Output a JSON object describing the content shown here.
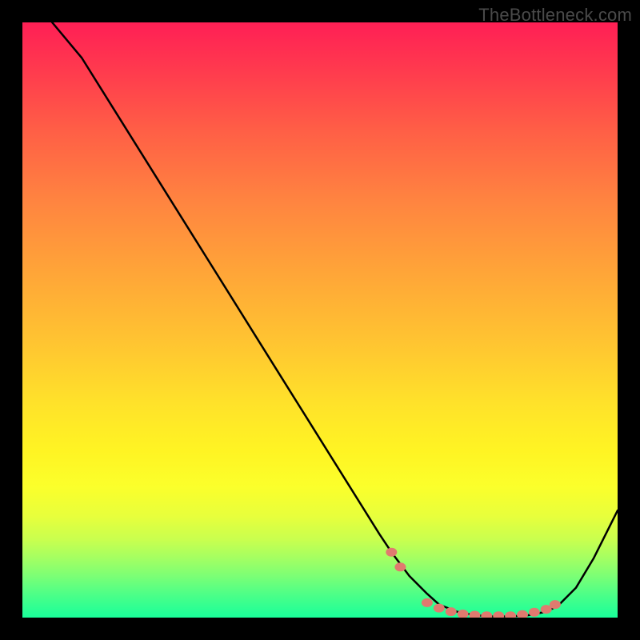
{
  "watermark": {
    "text": "TheBottleneck.com"
  },
  "chart_data": {
    "type": "line",
    "title": "",
    "xlabel": "",
    "ylabel": "",
    "xlim": [
      0,
      100
    ],
    "ylim": [
      0,
      100
    ],
    "grid": false,
    "legend": false,
    "series": [
      {
        "name": "bottleneck-curve",
        "color": "#000000",
        "x": [
          5,
          10,
          15,
          20,
          25,
          30,
          35,
          40,
          45,
          50,
          55,
          60,
          62,
          65,
          68,
          70,
          73,
          76,
          79,
          82,
          85,
          88,
          90,
          93,
          96,
          100
        ],
        "values": [
          100,
          94,
          86,
          78,
          70,
          62,
          54,
          46,
          38,
          30,
          22,
          14,
          11,
          7,
          4,
          2.2,
          1.0,
          0.4,
          0.2,
          0.2,
          0.4,
          1.0,
          2.0,
          5,
          10,
          18
        ]
      }
    ],
    "markers": {
      "name": "highlighted-points",
      "color": "#e07a6f",
      "points": [
        {
          "x": 62,
          "y": 11
        },
        {
          "x": 63.5,
          "y": 8.5
        },
        {
          "x": 68,
          "y": 2.5
        },
        {
          "x": 70,
          "y": 1.6
        },
        {
          "x": 72,
          "y": 1.0
        },
        {
          "x": 74,
          "y": 0.6
        },
        {
          "x": 76,
          "y": 0.4
        },
        {
          "x": 78,
          "y": 0.3
        },
        {
          "x": 80,
          "y": 0.3
        },
        {
          "x": 82,
          "y": 0.3
        },
        {
          "x": 84,
          "y": 0.5
        },
        {
          "x": 86,
          "y": 0.9
        },
        {
          "x": 88,
          "y": 1.4
        },
        {
          "x": 89.5,
          "y": 2.2
        }
      ]
    },
    "background_gradient": {
      "orientation": "vertical",
      "stops": [
        {
          "pos": 0.0,
          "color": "#ff1f55"
        },
        {
          "pos": 0.3,
          "color": "#ff8440"
        },
        {
          "pos": 0.55,
          "color": "#ffc531"
        },
        {
          "pos": 0.75,
          "color": "#fff423"
        },
        {
          "pos": 0.9,
          "color": "#a4ff62"
        },
        {
          "pos": 1.0,
          "color": "#19ff9a"
        }
      ]
    }
  }
}
